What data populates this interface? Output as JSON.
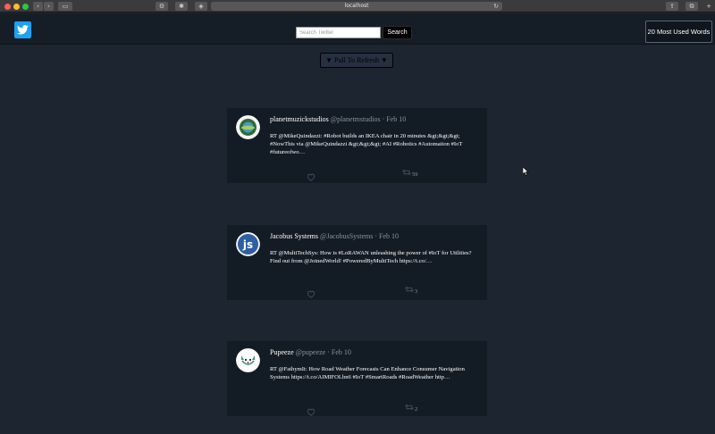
{
  "browser": {
    "url": "localhost"
  },
  "header": {
    "logo_icon": "twitter-bird-icon",
    "search_placeholder": "Search Twitter",
    "search_button": "Search",
    "most_used_button": "20 Most Used Words"
  },
  "refresh": {
    "label": "▼ Pull To Refresh ▼"
  },
  "tweets": [
    {
      "name": "planetmuzickstudios",
      "handle": "@planetmstudios",
      "date": "· Feb 10",
      "text": "RT @MikeQuindazzi: #Robot builds an IKEA chair in 20 minutes &gt;&gt;&gt; #NowThis via @MikeQuindazzi &gt;&gt;&gt; #AI #Robotics #Automation #IoT #futureofwo…",
      "retweets": "59"
    },
    {
      "name": "Jacobus Systems",
      "handle": "@JacobusSystems",
      "date": "· Feb 10",
      "text": "RT @MultiTechSys: How is #LoRAWAN unleashing the power of #IoT for Utilities? Find out from @JoinedWorld! #PoweredByMultiTech https://t.co/…",
      "retweets": "3"
    },
    {
      "name": "Pupeeze",
      "handle": "@pupeeze",
      "date": "· Feb 10",
      "text": "RT @FathymIt: How Road Weather Forecasts Can Enhance Consumer Navigation Systems https://t.co/AIMIFOLbn6 #IoT #SmartRoads #RoadWeather http…",
      "retweets": "2"
    }
  ]
}
